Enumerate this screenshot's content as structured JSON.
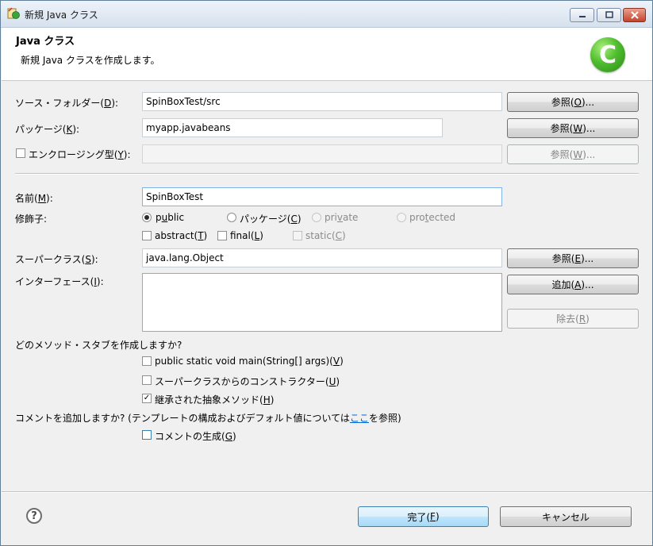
{
  "window": {
    "title": "新規 Java クラス",
    "controls": {
      "minimize_icon": "minimize-icon",
      "maximize_icon": "maximize-icon",
      "close_icon": "close-icon"
    }
  },
  "header": {
    "title": "Java クラス",
    "description": "新規 Java クラスを作成します。",
    "logo_glyph": "C"
  },
  "source_folder": {
    "label": "ソース・フォルダー(",
    "mnemonic": "D",
    "label_end": "):",
    "value": "SpinBoxTest/src",
    "button": {
      "pre": "参照(",
      "mn": "O",
      "post": ")..."
    }
  },
  "package": {
    "label": "パッケージ(",
    "mnemonic": "K",
    "label_end": "):",
    "value": "myapp.javabeans",
    "button": {
      "pre": "参照(",
      "mn": "W",
      "post": ")..."
    }
  },
  "enclosing": {
    "label": "エンクロージング型(",
    "mnemonic": "Y",
    "label_end": "):",
    "checked": false,
    "value": "",
    "button": {
      "pre": "参照(",
      "mn": "W",
      "post": ")..."
    }
  },
  "name": {
    "label": "名前(",
    "mnemonic": "M",
    "label_end": "):",
    "value": "SpinBoxTest"
  },
  "modifiers": {
    "label": "修飾子:",
    "radios": [
      {
        "label": "public",
        "mnemonic": "u",
        "pre": "p",
        "post": "blic",
        "selected": true,
        "enabled": true
      },
      {
        "label": "パッケージ(C)",
        "pre": "パッケージ(",
        "mn": "C",
        "post": ")",
        "selected": false,
        "enabled": true
      },
      {
        "label": "private",
        "pre": "pri",
        "mn": "v",
        "post": "ate",
        "selected": false,
        "enabled": false
      },
      {
        "label": "protected",
        "pre": "pro",
        "mn": "t",
        "post": "ected",
        "selected": false,
        "enabled": false
      }
    ],
    "checks": [
      {
        "pre": "abstract(",
        "mn": "T",
        "post": ")",
        "checked": false,
        "enabled": true
      },
      {
        "pre": "final(",
        "mn": "L",
        "post": ")",
        "checked": false,
        "enabled": true
      },
      {
        "pre": "static(",
        "mn": "C",
        "post": ")",
        "checked": false,
        "enabled": false
      }
    ]
  },
  "superclass": {
    "label": "スーパークラス(",
    "mnemonic": "S",
    "label_end": "):",
    "value": "java.lang.Object",
    "button": {
      "pre": "参照(",
      "mn": "E",
      "post": ")..."
    }
  },
  "interfaces": {
    "label": "インターフェース(",
    "mnemonic": "I",
    "label_end": "):",
    "add_button": {
      "pre": "追加(",
      "mn": "A",
      "post": ")..."
    },
    "remove_button": {
      "pre": "除去(",
      "mn": "R",
      "post": ")"
    }
  },
  "stubs": {
    "question": "どのメソッド・スタブを作成しますか?",
    "options": [
      {
        "pre": "public static void main(String[] args)(",
        "mn": "V",
        "post": ")",
        "checked": false
      },
      {
        "pre": "スーパークラスからのコンストラクター(",
        "mn": "U",
        "post": ")",
        "checked": false
      },
      {
        "pre": "継承された抽象メソッド(",
        "mn": "H",
        "post": ")",
        "checked": true
      }
    ]
  },
  "comments": {
    "question_pre": "コメントを追加しますか? (テンプレートの構成およびデフォルト値については",
    "question_link": "ここ",
    "question_post": "を参照)",
    "option": {
      "pre": "コメントの生成(",
      "mn": "G",
      "post": ")",
      "checked": false
    }
  },
  "footer": {
    "help_icon": "help-icon",
    "finish_button": {
      "pre": "完了(",
      "mn": "F",
      "post": ")"
    },
    "cancel_button": "キャンセル"
  }
}
